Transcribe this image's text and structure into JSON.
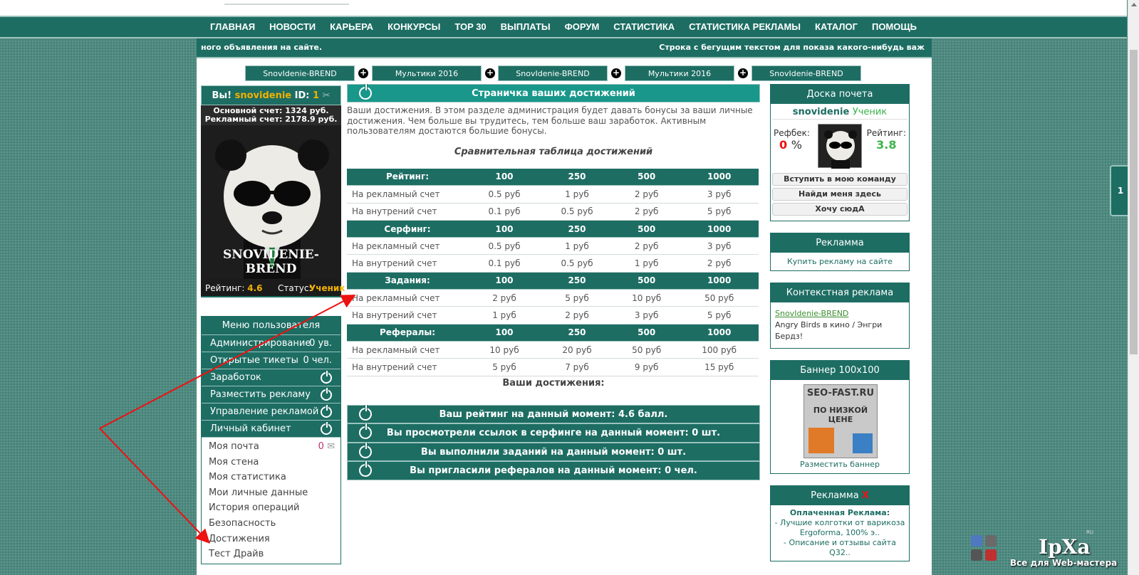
{
  "nav": [
    "ГЛАВНАЯ",
    "НОВОСТИ",
    "КАРЬЕРА",
    "КОНКУРСЫ",
    "TOP 30",
    "ВЫПЛАТЫ",
    "ФОРУМ",
    "СТАТИСТИКА",
    "СТАТИСТИКА РЕКЛАМЫ",
    "КАТАЛОГ",
    "ПОМОЩЬ"
  ],
  "ticker": {
    "left": "ного объявления на сайте.",
    "right": "Строка с бегущим текстом для показа какого-нибудь важ"
  },
  "adbar": [
    "SnovIdenie-BREND",
    "Мультики 2016",
    "SnovIdenie-BREND",
    "Мультики 2016",
    "SnovIdenie-BREND"
  ],
  "user": {
    "you": "Вы!",
    "name": "snovidenie",
    "id_label": "ID:",
    "id": "1",
    "main_balance": "Основной счет: 1324 руб.",
    "ad_balance": "Рекламный счет: 2178.9 руб.",
    "watermark": "SNOVIDENIE-BREND",
    "rating_label": "Рейтинг:",
    "rating": "4.6",
    "status_label": "Статус:",
    "status": "Ученик"
  },
  "menu": {
    "title": "Меню пользователя",
    "items": [
      {
        "label": "Администрирование",
        "value": "0 ув."
      },
      {
        "label": "Открытые тикеты",
        "value": "0 чел."
      },
      {
        "label": "Заработок"
      },
      {
        "label": "Разместить рекламу"
      },
      {
        "label": "Управление рекламой"
      },
      {
        "label": "Личный кабинет"
      }
    ],
    "sub": [
      "Моя почта",
      "Моя стена",
      "Моя статистика",
      "Мои личные данные",
      "История операций",
      "Безопасность",
      "Достижения",
      "Тест Драйв"
    ],
    "mail_count": "0"
  },
  "main": {
    "title": "Страничка ваших достижений",
    "intro": "Ваши достижения. В этом разделе администрация будет давать бонусы за ваши личные достижения. Чем больше вы трудитесь, тем больше ваш заработок. Активным пользователям достаются большие бонусы.",
    "caption": "Сравнительная таблица достижений",
    "your": "Ваши достижения:",
    "table": [
      {
        "h": [
          "Рейтинг:",
          "100",
          "250",
          "500",
          "1000"
        ],
        "rows": [
          [
            "На рекламный счет",
            "0.5 руб",
            "1 руб",
            "2 руб",
            "3 руб"
          ],
          [
            "На внутрений счет",
            "0.1 руб",
            "0.5 руб",
            "2 руб",
            "5 руб"
          ]
        ]
      },
      {
        "h": [
          "Серфинг:",
          "100",
          "250",
          "500",
          "1000"
        ],
        "rows": [
          [
            "На рекламный счет",
            "0.5 руб",
            "1 руб",
            "2 руб",
            "3 руб"
          ],
          [
            "На внутрений счет",
            "0.1 руб",
            "0.5 руб",
            "1 руб",
            "2 руб"
          ]
        ]
      },
      {
        "h": [
          "Задания:",
          "100",
          "250",
          "500",
          "1000"
        ],
        "rows": [
          [
            "На рекламный счет",
            "2 руб",
            "5 руб",
            "10 руб",
            "50 руб"
          ],
          [
            "На внутрений счет",
            "1 руб",
            "2 руб",
            "3 руб",
            "5 руб"
          ]
        ]
      },
      {
        "h": [
          "Рефералы:",
          "100",
          "250",
          "500",
          "1000"
        ],
        "rows": [
          [
            "На рекламный счет",
            "10 руб",
            "20 руб",
            "50 руб",
            "100 руб"
          ],
          [
            "На внутрений счет",
            "5 руб",
            "7 руб",
            "9 руб",
            "15 руб"
          ]
        ]
      }
    ],
    "achievements": [
      "Ваш рейтинг на данный момент: 4.6 балл.",
      "Вы просмотрели ссылок в серфинге на данный момент: 0 шт.",
      "Вы выполнили заданий на данный момент: 0 шт.",
      "Вы пригласили рефералов на данный момент: 0 чел."
    ]
  },
  "right": {
    "honor_title": "Доска почета",
    "honor_name": "snovidenie",
    "honor_rank": "Ученик",
    "refback_label": "Рефбек:",
    "refback": "0",
    "pct": "%",
    "rating_label": "Рейтинг:",
    "rating": "3.8",
    "honor_buttons": [
      "Вступить в мою команду",
      "Найди меня здесь",
      "Хочу сюдА"
    ],
    "ad_title": "Рекламма",
    "ad_link": "Купить рекламу на сайте",
    "ctx_title": "Контекстная реклама",
    "ctx_link": "SnovIdenie-BREND",
    "ctx_text": "Angry Birds в кино / Энгри Бердз!",
    "banner_title": "Баннер 100x100",
    "banner_text1": "SEO-FAST.RU",
    "banner_text2": "ПО НИЗКОЙ ЦЕНЕ",
    "banner_link": "Разместить баннер",
    "paid_title": "Рекламма",
    "paid_x": "X",
    "paid_head": "Оплаченная Реклама:",
    "paid_items": [
      "- Лучшие колготки от варикоза Ergoforma, 100% э..",
      "- Описание и отзывы сайта Q32.."
    ]
  },
  "sidetab": "1",
  "watermark": {
    "title": "IpXa",
    "sub": "Все для Web-мастера",
    "ru": "RU"
  },
  "colors": {
    "accent": "#1d6d63",
    "header_teal": "#18978a",
    "gold": "#f2b100",
    "red": "#e11111",
    "green": "#3bb44a"
  }
}
